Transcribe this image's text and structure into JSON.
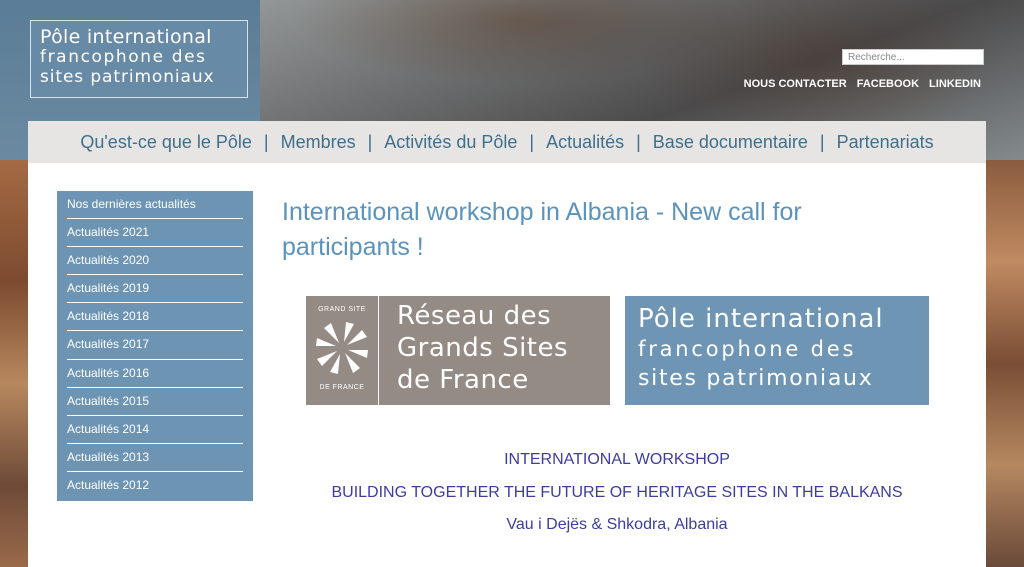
{
  "header": {
    "logo_lines": [
      "Pôle international",
      "francophone des",
      "sites patrimoniaux"
    ],
    "search_placeholder": "Recherche...",
    "top_links": [
      "NOUS CONTACTER",
      "FACEBOOK",
      "LINKEDIN"
    ]
  },
  "nav": {
    "items": [
      "Qu'est-ce que le Pôle",
      "Membres",
      "Activités du Pôle",
      "Actualités",
      "Base documentaire",
      "Partenariats"
    ]
  },
  "sidebar": {
    "items": [
      "Nos dernières actualités",
      "Actualités 2021",
      "Actualités 2020",
      "Actualités 2019",
      "Actualités 2018",
      "Actualités 2017",
      "Actualités 2016",
      "Actualités 2015",
      "Actualités 2014",
      "Actualités 2013",
      "Actualités 2012"
    ]
  },
  "article": {
    "title_line1": "International workshop in Albania - New call for",
    "title_line2": "participants !",
    "logo_gsf": {
      "emblem_top": "GRAND SITE",
      "emblem_bottom": "DE FRANCE",
      "lines": [
        "Réseau des",
        "Grands Sites",
        "de France"
      ]
    },
    "logo_pole": {
      "lines": [
        "Pôle international",
        "francophone des",
        "sites patrimoniaux"
      ]
    },
    "workshop_heading": "INTERNATIONAL WORKSHOP",
    "workshop_subtitle": "BUILDING TOGETHER THE FUTURE OF HERITAGE SITES IN THE BALKANS",
    "workshop_location": "Vau i Dejës & Shkodra, Albania"
  },
  "colors": {
    "accent_blue": "#5a93bd",
    "nav_text": "#3e6f8c",
    "sidebar_bg": "#6d95b3",
    "workshop_text": "#3c3d9e",
    "gsf_bg": "#958b85"
  }
}
